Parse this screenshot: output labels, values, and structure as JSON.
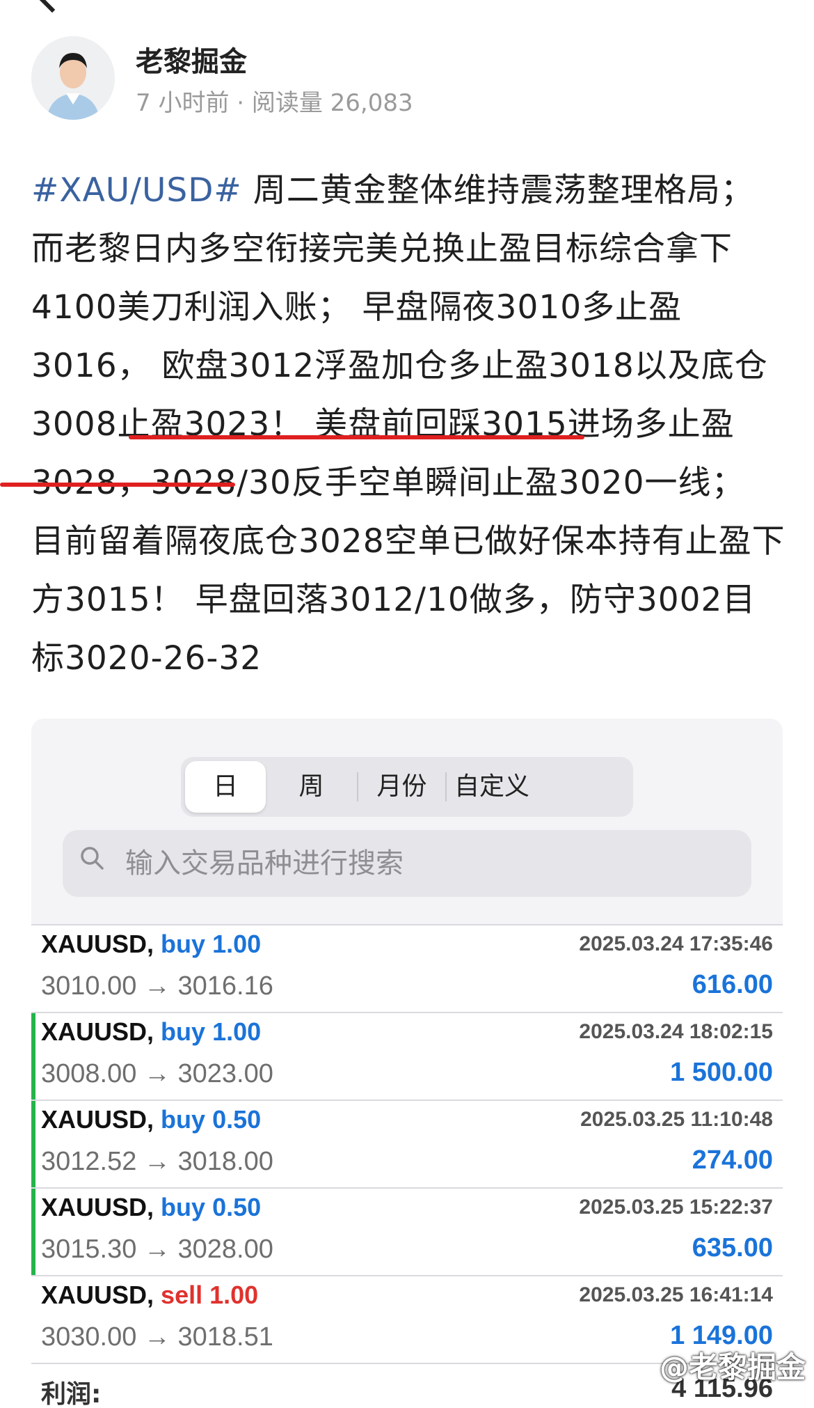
{
  "author": {
    "name": "老黎掘金",
    "meta": "7 小时前 · 阅读量 26,083"
  },
  "post": {
    "hashtag": "#XAU/USD#",
    "seg1": " 周二黄金整体维持震荡整理格局；而老黎日内多空衔接完美兑换止盈目标综合拿下4100美刀利润入账； 早盘隔夜3010多止盈3016， 欧盘3012浮盈加仓多止盈3018以及底仓3008止盈3023！ 美盘前回踩3015进场多止盈3028，3028/30反手空单瞬间止盈3020一线；",
    "seg2": " 目前留着隔夜底仓3028空单已做好保本持有止盈下方3015！",
    "seg3": " 早盘回落3012/10做多，防守3002目标3020-26-32"
  },
  "tabs": {
    "day": "日",
    "week": "周",
    "month": "月份",
    "custom": "自定义"
  },
  "search": {
    "placeholder": "输入交易品种进行搜索"
  },
  "trades": [
    {
      "symbol": "XAUUSD,",
      "direction": "buy",
      "volume": "1.00",
      "time": "2025.03.24 17:35:46",
      "prices": "3010.00 → 3016.16",
      "profit": "616.00"
    },
    {
      "symbol": "XAUUSD,",
      "direction": "buy",
      "volume": "1.00",
      "time": "2025.03.24 18:02:15",
      "prices": "3008.00 → 3023.00",
      "profit": "1 500.00"
    },
    {
      "symbol": "XAUUSD,",
      "direction": "buy",
      "volume": "0.50",
      "time": "2025.03.25 11:10:48",
      "prices": "3012.52 → 3018.00",
      "profit": "274.00"
    },
    {
      "symbol": "XAUUSD,",
      "direction": "buy",
      "volume": "0.50",
      "time": "2025.03.25 15:22:37",
      "prices": "3015.30 → 3028.00",
      "profit": "635.00"
    },
    {
      "symbol": "XAUUSD,",
      "direction": "sell",
      "volume": "1.00",
      "time": "2025.03.25 16:41:14",
      "prices": "3030.00 → 3018.51",
      "profit": "1 149.00"
    }
  ],
  "summary": {
    "label": "利润:",
    "value": "4 115.96"
  },
  "watermark": "@老黎掘金",
  "colors": {
    "buy": "#1a73d9",
    "sell": "#e0322e",
    "hashtag": "#3a62a0",
    "underline": "#e02020",
    "marker": "#25b34b"
  }
}
